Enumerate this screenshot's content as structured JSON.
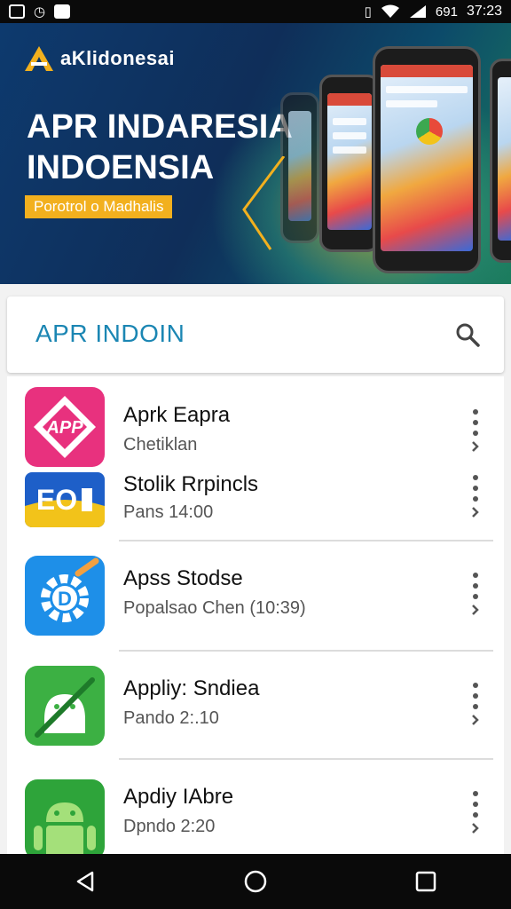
{
  "status_bar": {
    "time": "37:23",
    "battery": "691"
  },
  "banner": {
    "brand": "aKlidonesai",
    "title": "APR INDARESIA INDOENSIA",
    "tagline": "Porotrol o Madhalis"
  },
  "search": {
    "title": "APR INDOIN",
    "icon": "search-icon"
  },
  "apps": [
    {
      "title": "Aprk Eapra",
      "subtitle": "Chetiklan",
      "icon": "app-badge-icon",
      "icon_color": "#e8317e"
    },
    {
      "title": "Stolik Rrpincls",
      "subtitle": "Pans 14:00",
      "icon": "eo-tile-icon",
      "icon_color": "#f2c31a"
    },
    {
      "title": "Apss Stodse",
      "subtitle": "Popalsao Chen (10:39)",
      "icon": "d-gear-icon",
      "icon_color": "#1e8fe8"
    },
    {
      "title": "Appliy: Sndiea",
      "subtitle": "Pando 2:.10",
      "icon": "android-wrench-icon",
      "icon_color": "#3cb043"
    },
    {
      "title": "Apdiy IAbre",
      "subtitle": "Dpndo 2:20",
      "icon": "android-icon",
      "icon_color": "#2ea43a"
    }
  ],
  "nav": {
    "back": "back-icon",
    "home": "home-icon",
    "recents": "recents-icon"
  }
}
